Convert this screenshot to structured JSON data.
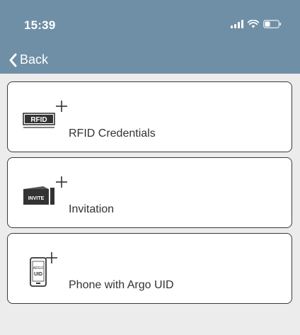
{
  "status_bar": {
    "time": "15:39",
    "icons": [
      "signal-icon",
      "wifi-icon",
      "battery-icon"
    ]
  },
  "nav": {
    "back_label": "Back",
    "back_icon": "chevron-left-icon"
  },
  "options": [
    {
      "label": "RFID Credentials",
      "icon": "rfid-card-add-icon",
      "icon_text": "RFID"
    },
    {
      "label": "Invitation",
      "icon": "invitation-add-icon",
      "icon_text": "INVITE"
    },
    {
      "label": "Phone with Argo UID",
      "icon": "phone-argo-uid-add-icon",
      "icon_text_top": "ARGO",
      "icon_text_bottom": "UID"
    }
  ],
  "colors": {
    "header": "#6f8fa6",
    "background": "#ececec",
    "card": "#ffffff",
    "card_border": "#3a3a3a"
  }
}
